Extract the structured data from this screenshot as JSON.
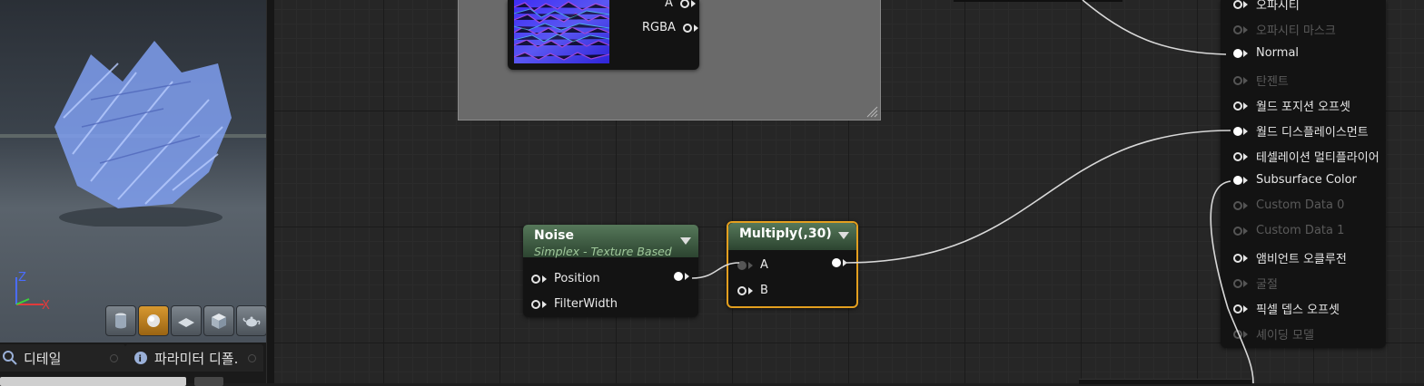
{
  "left_panel": {
    "axes": {
      "z": "Z",
      "x": "X"
    },
    "view_buttons": [
      "cylinder-icon",
      "sphere-icon",
      "plane-icon",
      "cube-icon",
      "teapot-icon"
    ],
    "tabs": [
      {
        "label": "디테일",
        "icon": "search-icon"
      },
      {
        "label": "파라미터 디폴.",
        "icon": "search-icon"
      }
    ]
  },
  "graph": {
    "texture_node": {
      "pins": [
        "A",
        "RGBA"
      ]
    },
    "noise_node": {
      "title": "Noise",
      "subtitle": "Simplex - Texture Based",
      "inputs": [
        "Position",
        "FilterWidth"
      ]
    },
    "multiply_node": {
      "title": "Multiply(,30)",
      "inputs": [
        "A",
        "B"
      ]
    },
    "material_output": {
      "pins": [
        {
          "label": "오파시티",
          "enabled": true
        },
        {
          "label": "오파시티 마스크",
          "enabled": false
        },
        {
          "label": "Normal",
          "enabled": true,
          "connected": true
        },
        {
          "label": "탄젠트",
          "enabled": false
        },
        {
          "label": "월드 포지션 오프셋",
          "enabled": true
        },
        {
          "label": "월드 디스플레이스먼트",
          "enabled": true,
          "connected": true
        },
        {
          "label": "테셀레이션 멀티플라이어",
          "enabled": true
        },
        {
          "label": "Subsurface Color",
          "enabled": true,
          "connected": true
        },
        {
          "label": "Custom Data 0",
          "enabled": false
        },
        {
          "label": "Custom Data 1",
          "enabled": false
        },
        {
          "label": "앰비언트 오클루전",
          "enabled": true
        },
        {
          "label": "굴절",
          "enabled": false
        },
        {
          "label": "픽셀 뎁스 오프셋",
          "enabled": true
        },
        {
          "label": "셰이딩 모델",
          "enabled": false
        }
      ]
    }
  },
  "colors": {
    "selected_border": "#e39f1f",
    "node_header": "#56785a",
    "wire": "#d8d8d8",
    "texture_preview": "#3a3ae0"
  }
}
